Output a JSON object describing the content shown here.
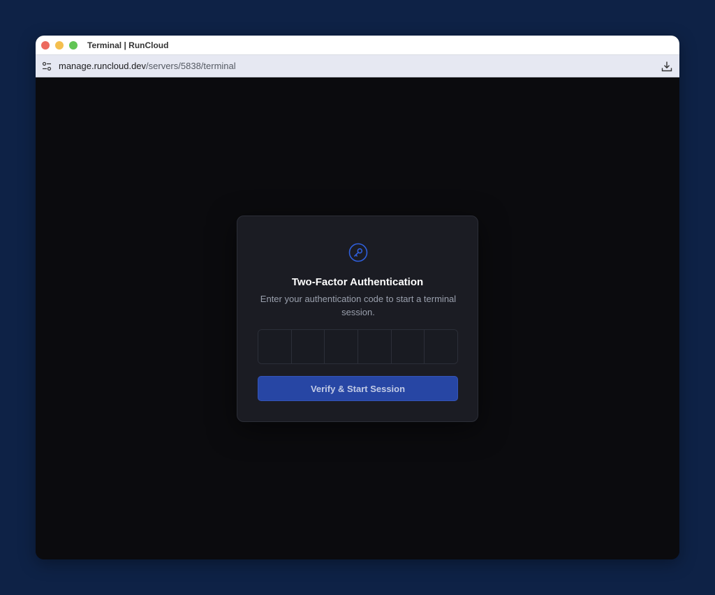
{
  "window": {
    "title": "Terminal | RunCloud"
  },
  "address": {
    "domain": "manage.runcloud.dev",
    "path": "/servers/5838/terminal"
  },
  "icons": {
    "site": "site-settings-icon",
    "download": "download-icon",
    "key": "key-icon"
  },
  "modal": {
    "title": "Two-Factor Authentication",
    "description": "Enter your authentication code to start a terminal session.",
    "code_digits": [
      "",
      "",
      "",
      "",
      "",
      ""
    ],
    "verify_label": "Verify & Start Session"
  },
  "colors": {
    "background": "#0e2246",
    "accent": "#2746a4",
    "icon_accent": "#2f5fdc"
  }
}
